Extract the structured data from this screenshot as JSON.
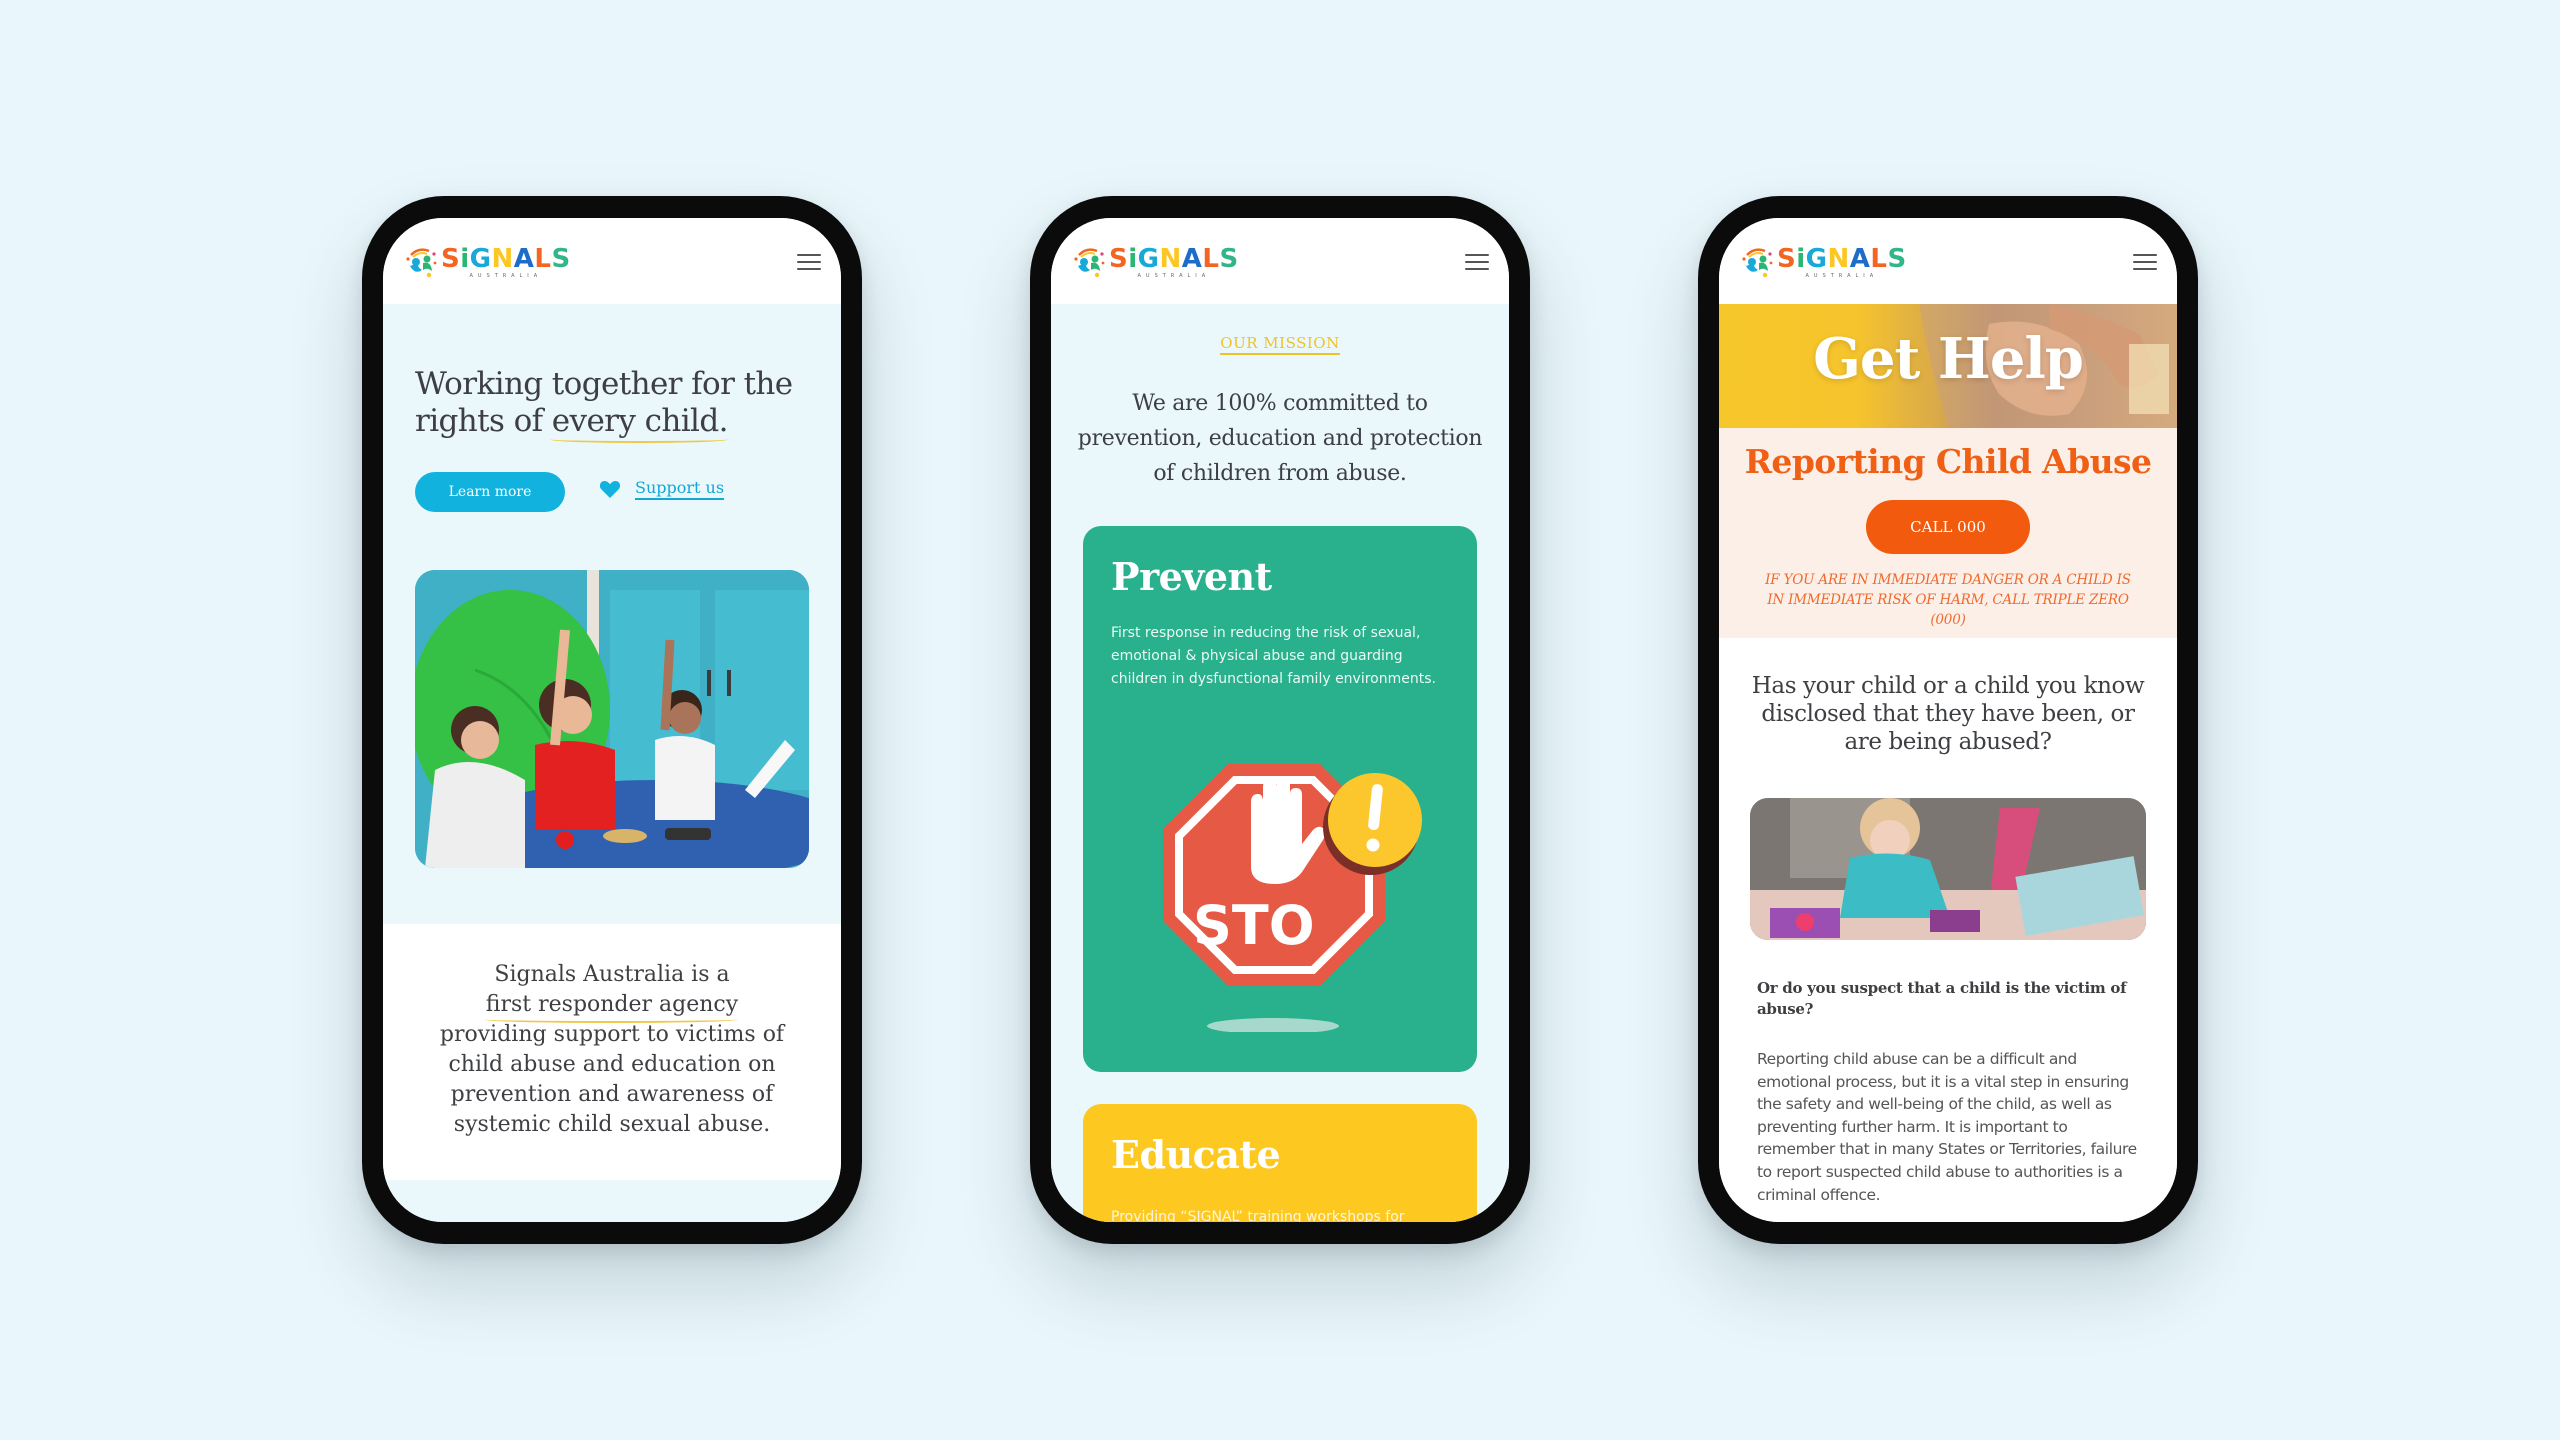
{
  "brand": {
    "name": "SiGNALS",
    "letters": [
      {
        "ch": "S",
        "color": "#f26522"
      },
      {
        "ch": "i",
        "color": "#2bb673"
      },
      {
        "ch": "G",
        "color": "#19a9d9"
      },
      {
        "ch": "N",
        "color": "#fdc621"
      },
      {
        "ch": "A",
        "color": "#1d6cc8"
      },
      {
        "ch": "L",
        "color": "#f26522"
      },
      {
        "ch": "S",
        "color": "#33b58a"
      }
    ],
    "subtitle": "AUSTRALIA"
  },
  "phones": [
    {
      "hero": {
        "title_prefix": "Working together for the rights of",
        "title_highlight": "every child.",
        "learn_more_label": "Learn more",
        "support_label": "Support us"
      },
      "photo_alt": "Children raising hands at a classroom table",
      "about": {
        "line1": "Signals Australia is a",
        "highlight": "first responder agency",
        "rest": "providing support to victims of child abuse and education on prevention and awareness of systemic child sexual abuse."
      }
    },
    {
      "mission_label": "OUR MISSION",
      "mission_text": "We are 100% committed to prevention, education and protection of children from abuse.",
      "cards": [
        {
          "title": "Prevent",
          "text": "First response in reducing the risk of sexual, emotional & physical abuse and guarding children in dysfunctional family environments.",
          "color": "#29b08d",
          "illustration": {
            "sign_text": "STO",
            "alert": "!"
          }
        },
        {
          "title": "Educate",
          "text": "Providing “SIGNAL” training workshops for",
          "color": "#fdc921"
        }
      ]
    },
    {
      "banner_title": "Get Help",
      "report_title": "Reporting Child Abuse",
      "call_label": "CALL 000",
      "warning": "IF YOU ARE IN IMMEDIATE DANGER OR A CHILD IS IN IMMEDIATE RISK OF HARM, CALL TRIPLE ZERO (000)",
      "question1": "Has your child or a child you know disclosed that they have been, or are being abused?",
      "photo_alt": "Toddler reading a picture book",
      "question2": "Or do you suspect that a child is the victim of abuse?",
      "paragraph": "Reporting child abuse can be a difficult and emotional process, but it is a vital step in ensuring the safety and well-being of the child, as well as preventing further harm. It is important to remember that in many States or Territories, failure to report suspected child abuse to authorities is a criminal offence."
    }
  ],
  "colors": {
    "background": "#e9f6fb",
    "primary_blue": "#12b2de",
    "accent_yellow": "#f2c744",
    "green": "#29b08d",
    "orange": "#f25b0d",
    "text": "#3d3f42"
  },
  "icons": {
    "menu": "hamburger-menu-icon",
    "heart": "heart-icon",
    "logo": "signals-logo-icon"
  }
}
